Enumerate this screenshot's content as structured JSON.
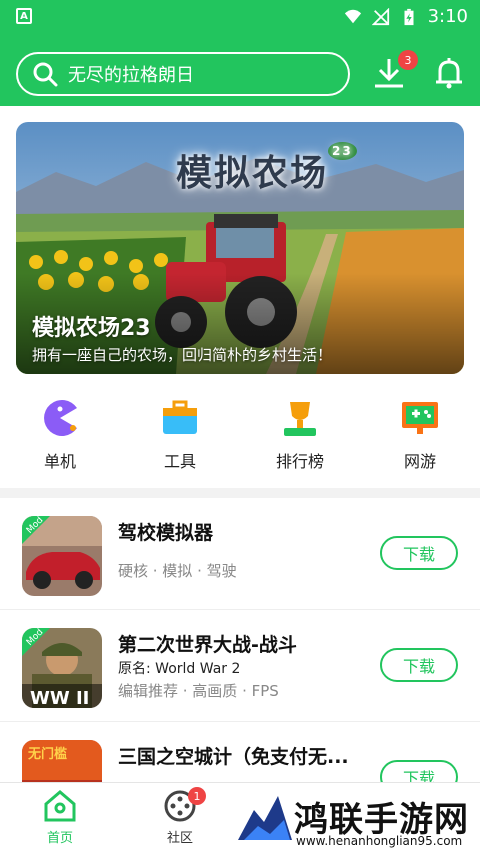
{
  "status": {
    "time": "3:10"
  },
  "search": {
    "placeholder": "无尽的拉格朗日"
  },
  "header": {
    "download_badge": "3"
  },
  "banner": {
    "logo_text": "模拟农场",
    "logo_num": "23",
    "title": "模拟农场23",
    "subtitle": "拥有一座自己的农场，回归简朴的乡村生活！"
  },
  "categories": [
    {
      "label": "单机",
      "icon": "pacman-icon"
    },
    {
      "label": "工具",
      "icon": "toolbox-icon"
    },
    {
      "label": "排行榜",
      "icon": "trophy-icon"
    },
    {
      "label": "网游",
      "icon": "gamepad-screen-icon"
    }
  ],
  "apps": [
    {
      "name": "驾校模拟器",
      "tags": "硬核 · 模拟 · 驾驶",
      "button": "下载",
      "thumb_badge": "Mod"
    },
    {
      "name": "第二次世界大战-战斗",
      "meta_label": "原名:",
      "meta_value": "World War 2",
      "tags": "编辑推荐 · 高画质 · FPS",
      "button": "下载",
      "thumb_badge": "Mod",
      "thumb_text": "WW II"
    },
    {
      "name": "三国之空城计（免支付无...",
      "button": "下载",
      "thumb_text": "无门槛"
    }
  ],
  "tabs": [
    {
      "label": "首页",
      "active": true
    },
    {
      "label": "社区",
      "badge": "1"
    }
  ],
  "watermark": {
    "title": "鸿联手游网",
    "url": "www.henanhonglian95.com"
  },
  "colors": {
    "accent": "#22c55e",
    "badge": "#ef4444"
  }
}
